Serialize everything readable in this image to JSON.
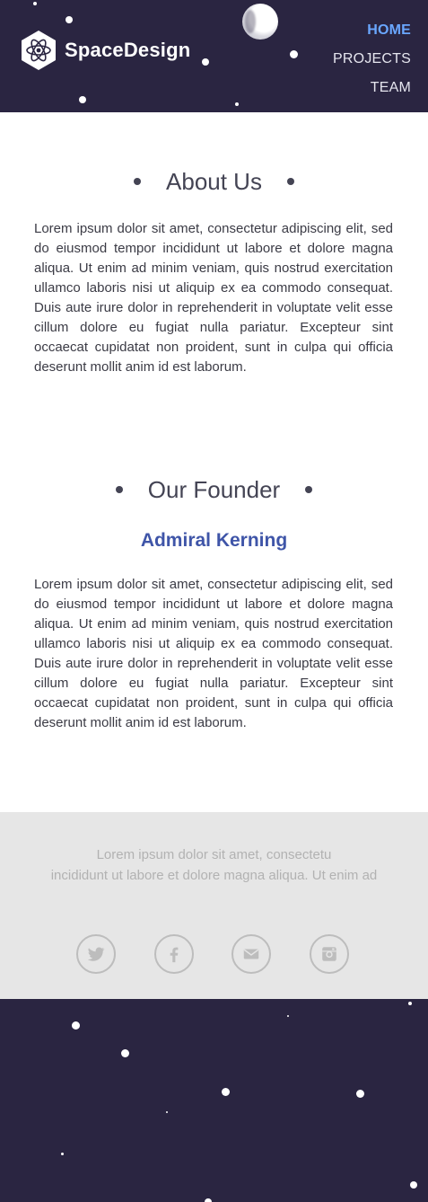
{
  "header": {
    "brand": "SpaceDesign",
    "nav": [
      "HOME",
      "PROJECTS",
      "TEAM"
    ],
    "active_index": 0
  },
  "about": {
    "title": "About Us",
    "text": "Lorem ipsum dolor sit amet, consectetur adipiscing elit, sed do eiusmod tempor incididunt ut labore et dolore magna aliqua. Ut enim ad minim veniam, quis nostrud exercitation ullamco laboris nisi ut aliquip ex ea commodo consequat. Duis aute irure dolor in reprehenderit in voluptate velit esse cillum dolore eu fugiat nulla pariatur. Excepteur sint occaecat cupidatat non proident, sunt in culpa qui officia deserunt mollit anim id est laborum."
  },
  "founder": {
    "title": "Our Founder",
    "name": "Admiral Kerning",
    "text": "Lorem ipsum dolor sit amet, consectetur adipiscing elit, sed do eiusmod tempor incididunt ut labore et dolore magna aliqua. Ut enim ad minim veniam, quis nostrud exercitation ullamco laboris nisi ut aliquip ex ea commodo consequat. Duis aute irure dolor in reprehenderit in voluptate velit esse cillum dolore eu fugiat nulla pariatur. Excepteur sint occaecat cupidatat non proident, sunt in culpa qui officia deserunt mollit anim id est laborum."
  },
  "footer": {
    "line1": "Lorem ipsum dolor sit amet, consectetu",
    "line2": "incididunt ut labore et dolore magna aliqua. Ut enim ad",
    "social": [
      "twitter-icon",
      "facebook-icon",
      "email-icon",
      "instagram-icon"
    ]
  },
  "colors": {
    "header_bg": "#2a2541",
    "nav_active": "#6aa7ff",
    "founder_name": "#3f55a8",
    "footer_bg": "#e6e6e6"
  }
}
